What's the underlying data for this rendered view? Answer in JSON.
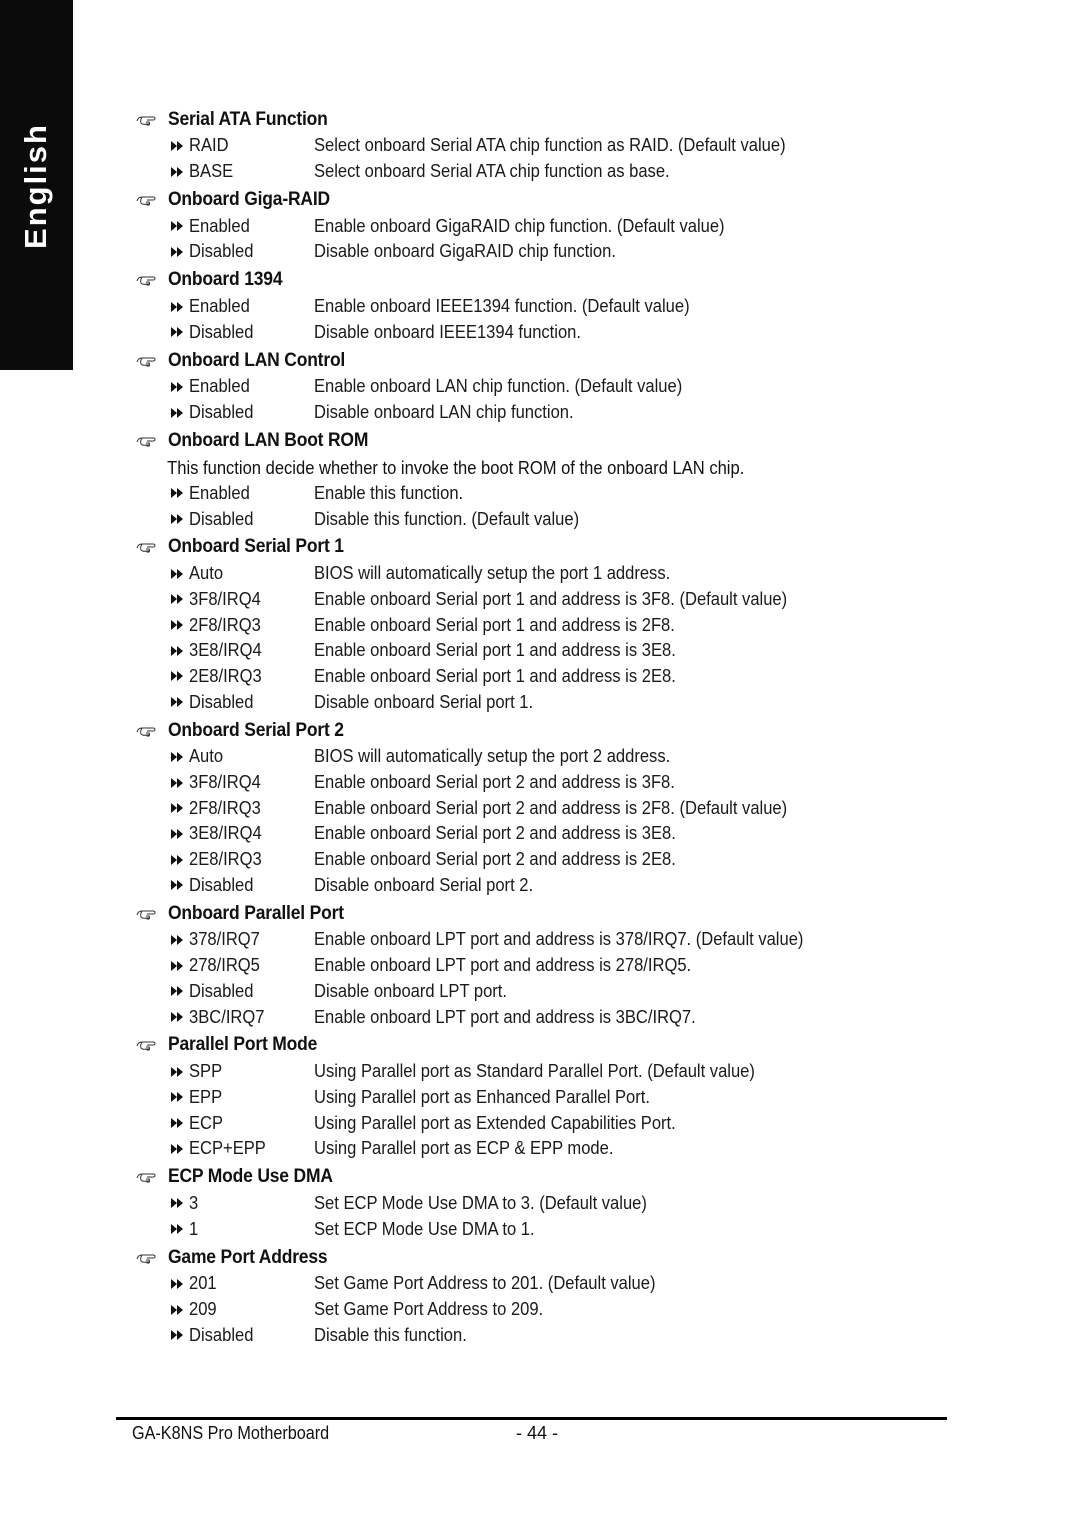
{
  "side_tab": {
    "label": "English"
  },
  "sections": [
    {
      "title": "Serial ATA Function",
      "options": [
        {
          "value": "RAID",
          "description": "Select onboard Serial ATA chip function as RAID. (Default value)"
        },
        {
          "value": "BASE",
          "description": "Select onboard Serial ATA chip function as base."
        }
      ]
    },
    {
      "title": "Onboard Giga-RAID",
      "options": [
        {
          "value": "Enabled",
          "description": "Enable onboard GigaRAID chip function. (Default value)"
        },
        {
          "value": "Disabled",
          "description": "Disable onboard GigaRAID chip function."
        }
      ]
    },
    {
      "title": "Onboard 1394",
      "options": [
        {
          "value": "Enabled",
          "description": "Enable onboard IEEE1394 function. (Default value)"
        },
        {
          "value": "Disabled",
          "description": "Disable onboard IEEE1394 function."
        }
      ]
    },
    {
      "title": "Onboard LAN Control",
      "options": [
        {
          "value": "Enabled",
          "description": "Enable onboard LAN chip function. (Default value)"
        },
        {
          "value": "Disabled",
          "description": "Disable onboard LAN chip function."
        }
      ]
    },
    {
      "title": "Onboard LAN Boot ROM",
      "note": "This function decide whether to invoke the boot ROM of the onboard LAN chip.",
      "options": [
        {
          "value": "Enabled",
          "description": "Enable this function."
        },
        {
          "value": "Disabled",
          "description": "Disable this function. (Default value)"
        }
      ]
    },
    {
      "title": "Onboard Serial Port 1",
      "options": [
        {
          "value": "Auto",
          "description": "BIOS will automatically setup the port 1 address."
        },
        {
          "value": "3F8/IRQ4",
          "description": "Enable onboard Serial port 1 and address is 3F8. (Default value)"
        },
        {
          "value": "2F8/IRQ3",
          "description": "Enable onboard Serial port 1 and address is 2F8."
        },
        {
          "value": "3E8/IRQ4",
          "description": "Enable onboard Serial port 1 and address is 3E8."
        },
        {
          "value": "2E8/IRQ3",
          "description": "Enable onboard Serial port 1 and address is 2E8."
        },
        {
          "value": "Disabled",
          "description": "Disable onboard Serial port 1."
        }
      ]
    },
    {
      "title": "Onboard Serial Port 2",
      "options": [
        {
          "value": "Auto",
          "description": "BIOS will automatically setup the port 2 address."
        },
        {
          "value": "3F8/IRQ4",
          "description": "Enable onboard Serial port 2 and address is 3F8."
        },
        {
          "value": "2F8/IRQ3",
          "description": "Enable onboard Serial port 2 and address is 2F8. (Default value)"
        },
        {
          "value": "3E8/IRQ4",
          "description": "Enable onboard Serial port 2 and address is 3E8."
        },
        {
          "value": "2E8/IRQ3",
          "description": "Enable onboard Serial port 2 and address is 2E8."
        },
        {
          "value": "Disabled",
          "description": "Disable onboard Serial port 2."
        }
      ]
    },
    {
      "title": "Onboard Parallel Port",
      "options": [
        {
          "value": "378/IRQ7",
          "description": "Enable onboard LPT port and address is 378/IRQ7. (Default value)"
        },
        {
          "value": "278/IRQ5",
          "description": "Enable onboard LPT port and address is 278/IRQ5."
        },
        {
          "value": "Disabled",
          "description": "Disable onboard LPT port."
        },
        {
          "value": "3BC/IRQ7",
          "description": "Enable onboard LPT port and address is 3BC/IRQ7."
        }
      ]
    },
    {
      "title": "Parallel Port Mode",
      "options": [
        {
          "value": "SPP",
          "description": "Using Parallel port as Standard Parallel Port. (Default value)"
        },
        {
          "value": "EPP",
          "description": "Using Parallel port as Enhanced Parallel Port."
        },
        {
          "value": "ECP",
          "description": "Using Parallel port as Extended Capabilities Port."
        },
        {
          "value": "ECP+EPP",
          "description": "Using Parallel port as ECP & EPP mode."
        }
      ]
    },
    {
      "title": "ECP Mode Use DMA",
      "options": [
        {
          "value": "3",
          "description": "Set ECP Mode Use DMA to 3. (Default value)"
        },
        {
          "value": "1",
          "description": "Set ECP Mode Use DMA to 1."
        }
      ]
    },
    {
      "title": "Game Port Address",
      "options": [
        {
          "value": "201",
          "description": "Set Game Port Address to 201. (Default value)"
        },
        {
          "value": "209",
          "description": "Set Game Port Address to 209."
        },
        {
          "value": "Disabled",
          "description": "Disable this function."
        }
      ]
    }
  ],
  "footer": {
    "product": "GA-K8NS Pro Motherboard",
    "page": "- 44 -"
  }
}
